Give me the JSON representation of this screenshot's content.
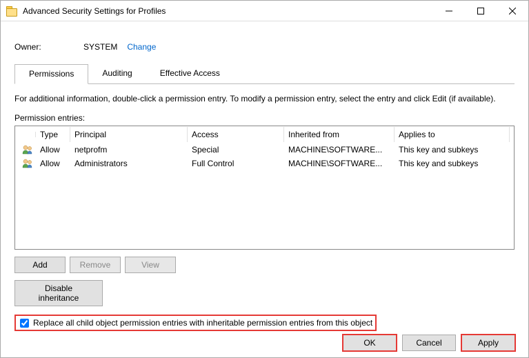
{
  "window": {
    "title": "Advanced Security Settings for Profiles"
  },
  "owner": {
    "label": "Owner:",
    "value": "SYSTEM",
    "change_link": "Change"
  },
  "tabs": {
    "permissions": "Permissions",
    "auditing": "Auditing",
    "effective": "Effective Access"
  },
  "instruction": "For additional information, double-click a permission entry. To modify a permission entry, select the entry and click Edit (if available).",
  "entries_label": "Permission entries:",
  "columns": {
    "type": "Type",
    "principal": "Principal",
    "access": "Access",
    "inherited": "Inherited from",
    "applies": "Applies to"
  },
  "entries": [
    {
      "type": "Allow",
      "principal": "netprofm",
      "access": "Special",
      "inherited": "MACHINE\\SOFTWARE...",
      "applies": "This key and subkeys"
    },
    {
      "type": "Allow",
      "principal": "Administrators",
      "access": "Full Control",
      "inherited": "MACHINE\\SOFTWARE...",
      "applies": "This key and subkeys"
    }
  ],
  "buttons": {
    "add": "Add",
    "remove": "Remove",
    "view": "View",
    "disable_inheritance": "Disable inheritance",
    "ok": "OK",
    "cancel": "Cancel",
    "apply": "Apply"
  },
  "checkbox": {
    "replace_label": "Replace all child object permission entries with inheritable permission entries from this object"
  }
}
